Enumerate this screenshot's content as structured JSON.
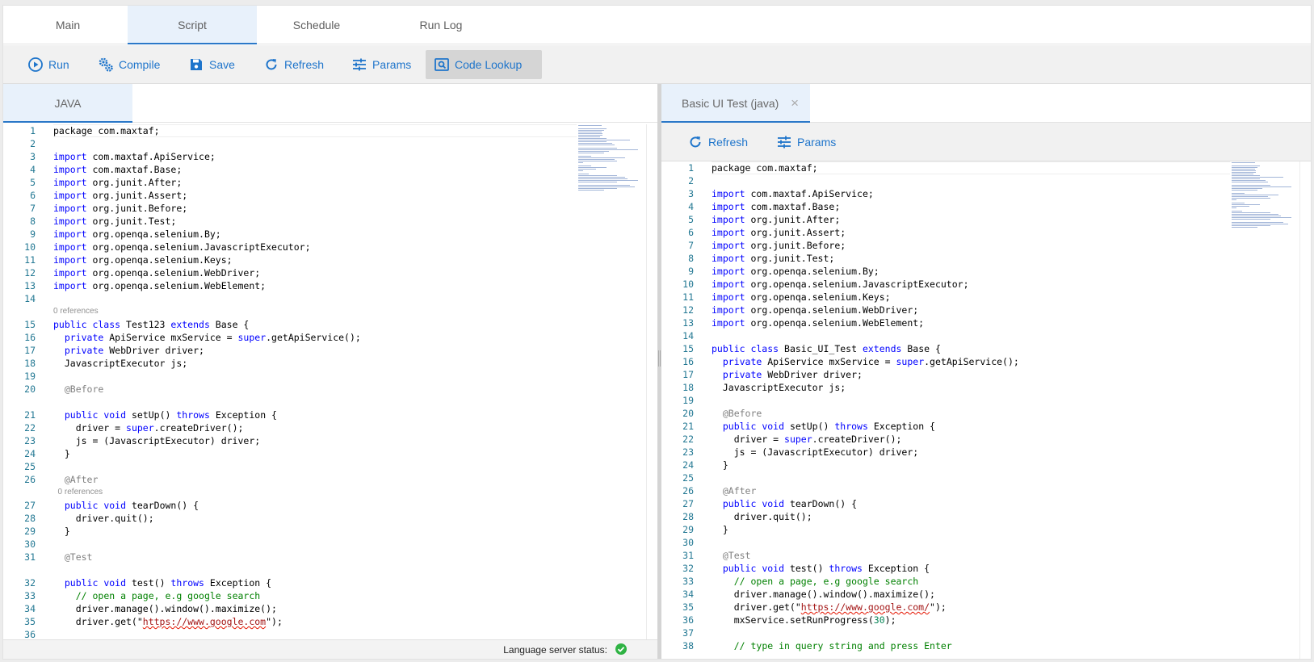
{
  "tabs": [
    {
      "label": "Main",
      "active": false
    },
    {
      "label": "Script",
      "active": true
    },
    {
      "label": "Schedule",
      "active": false
    },
    {
      "label": "Run Log",
      "active": false
    }
  ],
  "toolbar": {
    "run": "Run",
    "compile": "Compile",
    "save": "Save",
    "refresh": "Refresh",
    "params": "Params",
    "code_lookup": "Code Lookup"
  },
  "left_pane": {
    "tab_label": "JAVA",
    "status_label": "Language server status:",
    "lines": [
      {
        "n": "1",
        "html": "package com.maxtaf;"
      },
      {
        "n": "2",
        "html": ""
      },
      {
        "n": "3",
        "html": "<span class='kw'>import</span> com.maxtaf.ApiService;"
      },
      {
        "n": "4",
        "html": "<span class='kw'>import</span> com.maxtaf.Base;"
      },
      {
        "n": "5",
        "html": "<span class='kw'>import</span> org.junit.After;"
      },
      {
        "n": "6",
        "html": "<span class='kw'>import</span> org.junit.Assert;"
      },
      {
        "n": "7",
        "html": "<span class='kw'>import</span> org.junit.Before;"
      },
      {
        "n": "8",
        "html": "<span class='kw'>import</span> org.junit.Test;"
      },
      {
        "n": "9",
        "html": "<span class='kw'>import</span> org.openqa.selenium.By;"
      },
      {
        "n": "10",
        "html": "<span class='kw'>import</span> org.openqa.selenium.JavascriptExecutor;"
      },
      {
        "n": "11",
        "html": "<span class='kw'>import</span> org.openqa.selenium.Keys;"
      },
      {
        "n": "12",
        "html": "<span class='kw'>import</span> org.openqa.selenium.WebDriver;"
      },
      {
        "n": "13",
        "html": "<span class='kw'>import</span> org.openqa.selenium.WebElement;"
      },
      {
        "n": "14",
        "html": ""
      },
      {
        "ref": "0 references"
      },
      {
        "n": "15",
        "html": "<span class='kw'>public class</span> Test123 <span class='kw'>extends</span> Base {"
      },
      {
        "n": "16",
        "html": "  <span class='kw'>private</span> ApiService mxService = <span class='kw'>super</span>.getApiService();"
      },
      {
        "n": "17",
        "html": "  <span class='kw'>private</span> WebDriver driver;"
      },
      {
        "n": "18",
        "html": "  JavascriptExecutor js;"
      },
      {
        "n": "19",
        "html": ""
      },
      {
        "n": "20",
        "html": "  <span class='ann'>@Before</span>"
      },
      {
        "blank": true
      },
      {
        "n": "21",
        "html": "  <span class='kw'>public void</span> setUp() <span class='kw'>throws</span> Exception {"
      },
      {
        "n": "22",
        "html": "    driver = <span class='kw'>super</span>.createDriver();"
      },
      {
        "n": "23",
        "html": "    js = (JavascriptExecutor) driver;"
      },
      {
        "n": "24",
        "html": "  }"
      },
      {
        "n": "25",
        "html": ""
      },
      {
        "n": "26",
        "html": "  <span class='ann'>@After</span>"
      },
      {
        "ref": "  0 references"
      },
      {
        "n": "27",
        "html": "  <span class='kw'>public void</span> tearDown() {"
      },
      {
        "n": "28",
        "html": "    driver.quit();"
      },
      {
        "n": "29",
        "html": "  }"
      },
      {
        "n": "30",
        "html": ""
      },
      {
        "n": "31",
        "html": "  <span class='ann'>@Test</span>"
      },
      {
        "blank": true
      },
      {
        "n": "32",
        "html": "  <span class='kw'>public void</span> test() <span class='kw'>throws</span> Exception {"
      },
      {
        "n": "33",
        "html": "    <span class='cmt'>// open a page, e.g google search</span>"
      },
      {
        "n": "34",
        "html": "    driver.manage().window().maximize();"
      },
      {
        "n": "35",
        "html": "    driver.get(\"<span class='str'>https://www.google.com</span>\");"
      },
      {
        "n": "36",
        "html": ""
      }
    ]
  },
  "right_pane": {
    "tab_label": "Basic UI Test (java)",
    "refresh": "Refresh",
    "params": "Params",
    "lines": [
      {
        "n": "1",
        "html": "package com.maxtaf;"
      },
      {
        "n": "2",
        "html": ""
      },
      {
        "n": "3",
        "html": "<span class='kw'>import</span> com.maxtaf.ApiService;"
      },
      {
        "n": "4",
        "html": "<span class='kw'>import</span> com.maxtaf.Base;"
      },
      {
        "n": "5",
        "html": "<span class='kw'>import</span> org.junit.After;"
      },
      {
        "n": "6",
        "html": "<span class='kw'>import</span> org.junit.Assert;"
      },
      {
        "n": "7",
        "html": "<span class='kw'>import</span> org.junit.Before;"
      },
      {
        "n": "8",
        "html": "<span class='kw'>import</span> org.junit.Test;"
      },
      {
        "n": "9",
        "html": "<span class='kw'>import</span> org.openqa.selenium.By;"
      },
      {
        "n": "10",
        "html": "<span class='kw'>import</span> org.openqa.selenium.JavascriptExecutor;"
      },
      {
        "n": "11",
        "html": "<span class='kw'>import</span> org.openqa.selenium.Keys;"
      },
      {
        "n": "12",
        "html": "<span class='kw'>import</span> org.openqa.selenium.WebDriver;"
      },
      {
        "n": "13",
        "html": "<span class='kw'>import</span> org.openqa.selenium.WebElement;"
      },
      {
        "n": "14",
        "html": ""
      },
      {
        "n": "15",
        "html": "<span class='kw'>public class</span> Basic_UI_Test <span class='kw'>extends</span> Base {"
      },
      {
        "n": "16",
        "html": "  <span class='kw'>private</span> ApiService mxService = <span class='kw'>super</span>.getApiService();"
      },
      {
        "n": "17",
        "html": "  <span class='kw'>private</span> WebDriver driver;"
      },
      {
        "n": "18",
        "html": "  JavascriptExecutor js;"
      },
      {
        "n": "19",
        "html": ""
      },
      {
        "n": "20",
        "html": "  <span class='ann'>@Before</span>"
      },
      {
        "n": "21",
        "html": "  <span class='kw'>public void</span> setUp() <span class='kw'>throws</span> Exception {"
      },
      {
        "n": "22",
        "html": "    driver = <span class='kw'>super</span>.createDriver();"
      },
      {
        "n": "23",
        "html": "    js = (JavascriptExecutor) driver;"
      },
      {
        "n": "24",
        "html": "  }"
      },
      {
        "n": "25",
        "html": ""
      },
      {
        "n": "26",
        "html": "  <span class='ann'>@After</span>"
      },
      {
        "n": "27",
        "html": "  <span class='kw'>public void</span> tearDown() {"
      },
      {
        "n": "28",
        "html": "    driver.quit();"
      },
      {
        "n": "29",
        "html": "  }"
      },
      {
        "n": "30",
        "html": ""
      },
      {
        "n": "31",
        "html": "  <span class='ann'>@Test</span>"
      },
      {
        "n": "32",
        "html": "  <span class='kw'>public void</span> test() <span class='kw'>throws</span> Exception {"
      },
      {
        "n": "33",
        "html": "    <span class='cmt'>// open a page, e.g google search</span>"
      },
      {
        "n": "34",
        "html": "    driver.manage().window().maximize();"
      },
      {
        "n": "35",
        "html": "    driver.get(\"<span class='str'>https://www.google.com/</span>\");"
      },
      {
        "n": "36",
        "html": "    mxService.setRunProgress(<span class='num'>30</span>);"
      },
      {
        "n": "37",
        "html": ""
      },
      {
        "n": "38",
        "html": "    <span class='cmt'>// type in query string and press Enter</span>"
      }
    ]
  }
}
